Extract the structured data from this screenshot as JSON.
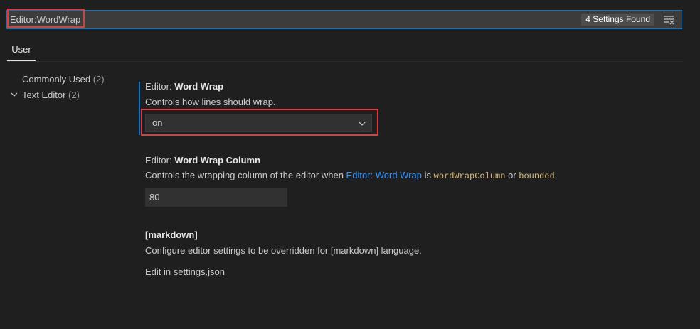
{
  "search": {
    "value": "Editor:WordWrap",
    "results_badge": "4 Settings Found",
    "clear_icon": "clear-filter-icon"
  },
  "tabs": [
    {
      "label": "User",
      "active": true
    }
  ],
  "toc": {
    "items": [
      {
        "label": "Commonly Used",
        "count": "(2)"
      },
      {
        "label": "Text Editor",
        "count": "(2)",
        "expanded": true
      }
    ]
  },
  "settings": {
    "word_wrap": {
      "category": "Editor: ",
      "name": "Word Wrap",
      "description": "Controls how lines should wrap.",
      "value": "on"
    },
    "word_wrap_column": {
      "category": "Editor: ",
      "name": "Word Wrap Column",
      "desc_prefix": "Controls the wrapping column of the editor when ",
      "desc_link": "Editor: Word Wrap",
      "desc_is": " is ",
      "desc_code1": "wordWrapColumn",
      "desc_or": " or ",
      "desc_code2": "bounded",
      "desc_end": ".",
      "value": "80"
    },
    "markdown": {
      "title": "[markdown]",
      "description": "Configure editor settings to be overridden for [markdown] language.",
      "edit_link": "Edit in settings.json"
    }
  },
  "colors": {
    "accent": "#0078d4",
    "highlight_box": "#e13b3b",
    "link": "#3794ff",
    "code": "#d7ba7d"
  }
}
